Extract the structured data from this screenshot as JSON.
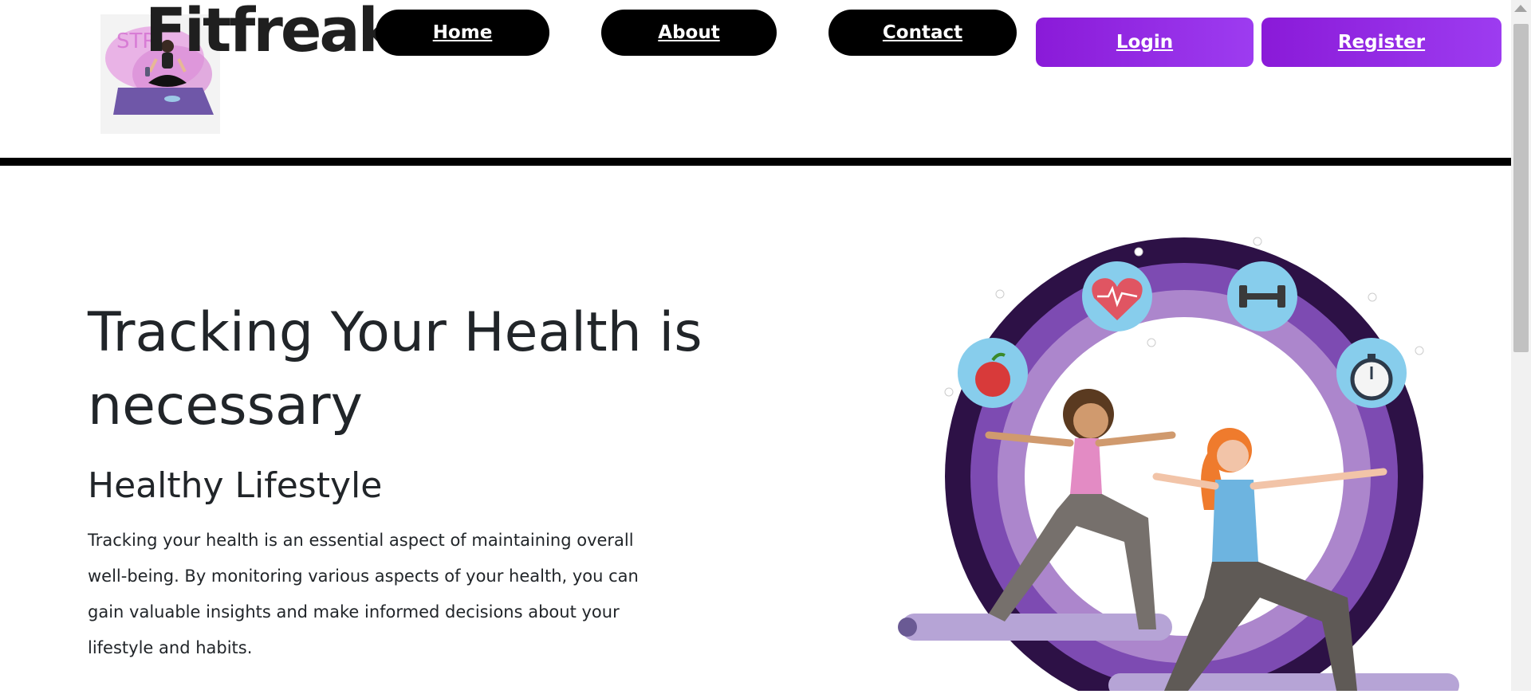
{
  "header": {
    "brand": "Fitfreak",
    "logo_image": "yoga-woman-logo",
    "nav": [
      {
        "label": "Home"
      },
      {
        "label": "About"
      },
      {
        "label": "Contact"
      }
    ],
    "auth": {
      "login": "Login",
      "register": "Register"
    }
  },
  "hero": {
    "title": "Tracking Your Health is necessary",
    "subtitle": "Healthy Lifestyle",
    "body": "Tracking your health is an essential aspect of maintaining overall well-being. By monitoring various aspects of your health, you can gain valuable insights and make informed decisions about your lifestyle and habits.",
    "illustration_icons": [
      "apple-icon",
      "heartbeat-icon",
      "dumbbell-icon",
      "stopwatch-icon"
    ]
  },
  "colors": {
    "nav_pill": "#000000",
    "auth_gradient_start": "#8a1ad8",
    "auth_gradient_end": "#9d3cf0",
    "ring_outer": "#2d1146",
    "ring_mid": "#7d4bb2",
    "ring_inner": "#ac86cc",
    "icon_badge": "#87cdec"
  }
}
